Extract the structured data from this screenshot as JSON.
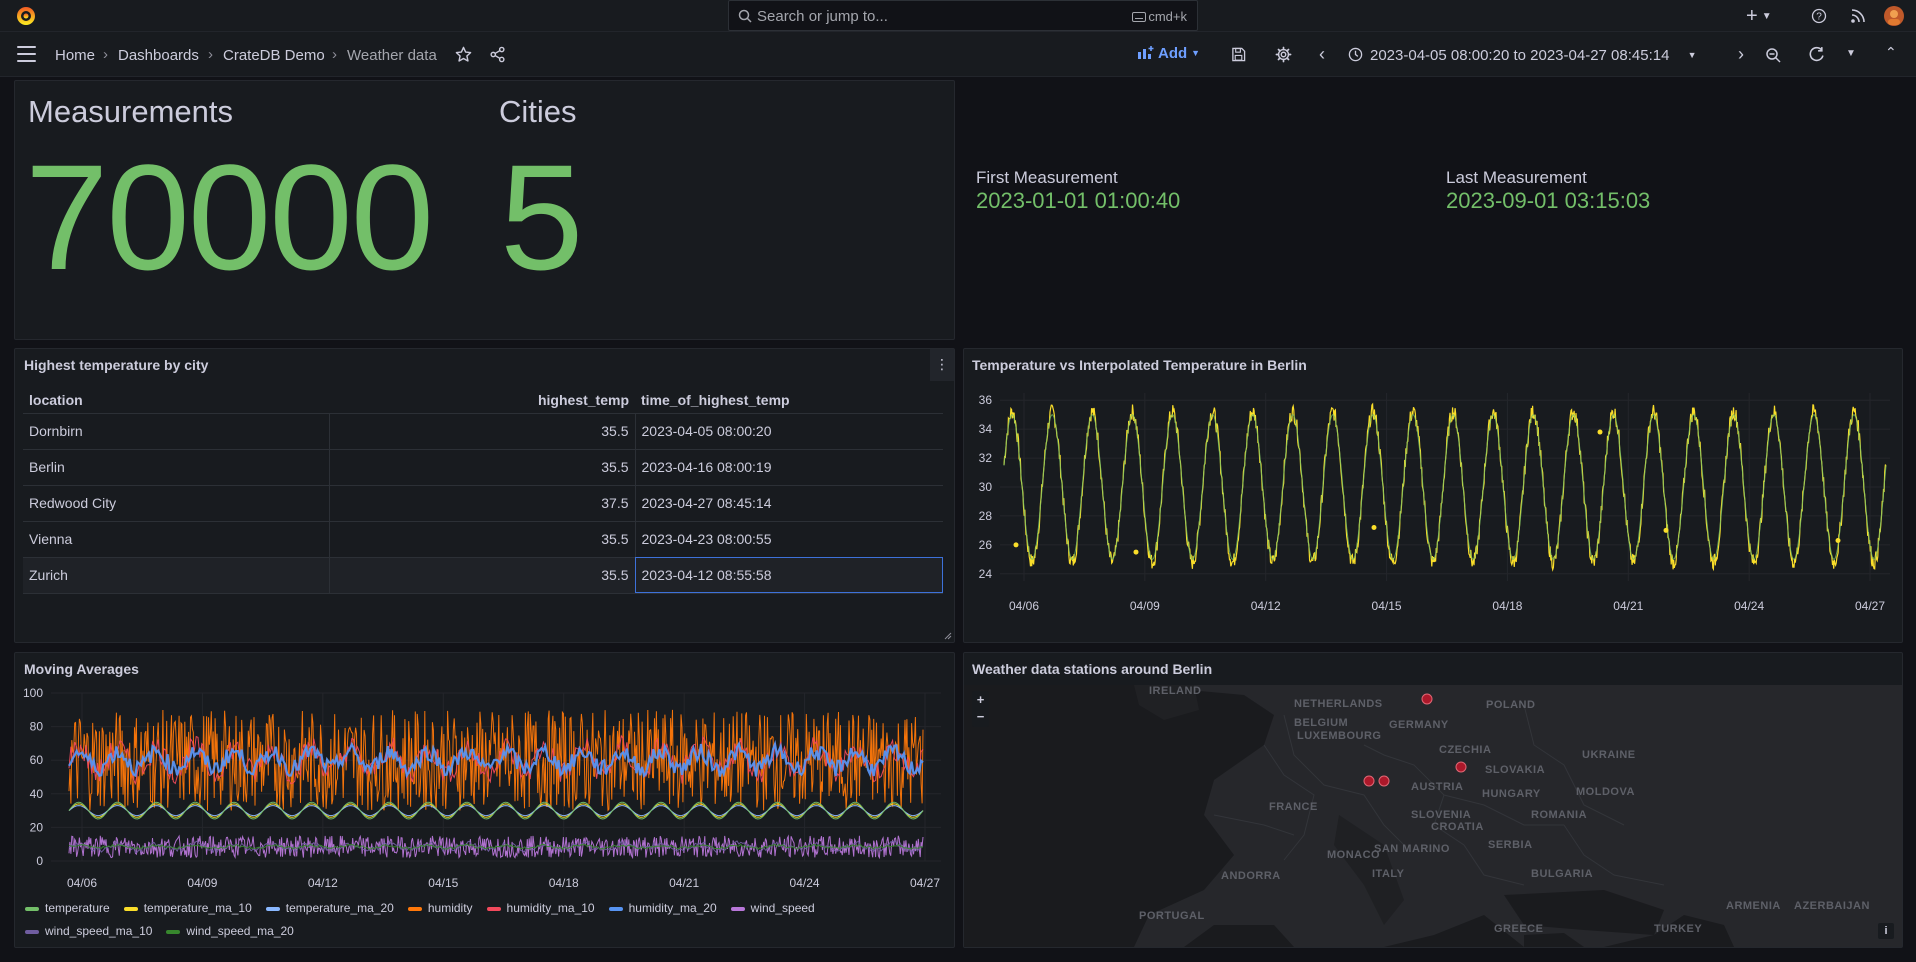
{
  "topbar": {
    "search_placeholder": "Search or jump to...",
    "search_shortcut": "cmd+k"
  },
  "breadcrumb": {
    "items": [
      "Home",
      "Dashboards",
      "CrateDB Demo",
      "Weather data"
    ]
  },
  "toolbar": {
    "add_label": "Add",
    "time_from": "2023-04-05 08:00:20",
    "time_to_word": "to",
    "time_to": "2023-04-27 08:45:14"
  },
  "stats": {
    "measurements_title": "Measurements",
    "measurements_value": "70000",
    "cities_title": "Cities",
    "cities_value": "5",
    "first_title": "First Measurement",
    "first_value": "2023-01-01 01:00:40",
    "last_title": "Last Measurement",
    "last_value": "2023-09-01 03:15:03"
  },
  "table_panel": {
    "title": "Highest temperature by city",
    "columns": [
      "location",
      "highest_temp",
      "time_of_highest_temp"
    ],
    "rows": [
      [
        "Dornbirn",
        "35.5",
        "2023-04-05 08:00:20"
      ],
      [
        "Berlin",
        "35.5",
        "2023-04-16 08:00:19"
      ],
      [
        "Redwood City",
        "37.5",
        "2023-04-27 08:45:14"
      ],
      [
        "Vienna",
        "35.5",
        "2023-04-23 08:00:55"
      ],
      [
        "Zurich",
        "35.5",
        "2023-04-12 08:55:58"
      ]
    ]
  },
  "map_panel": {
    "title": "Weather data stations around Berlin",
    "zoom_in": "+",
    "zoom_out": "−",
    "info": "i",
    "labels": [
      "IRELAND",
      "NETHERLANDS",
      "POLAND",
      "BELGIUM",
      "GERMANY",
      "LUXEMBOURG",
      "CZECHIA",
      "UKRAINE",
      "SLOVAKIA",
      "AUSTRIA",
      "MOLDOVA",
      "FRANCE",
      "HUNGARY",
      "SLOVENIA",
      "ROMANIA",
      "CROATIA",
      "SERBIA",
      "MONACO",
      "SAN MARINO",
      "ANDORRA",
      "ITALY",
      "BULGARIA",
      "PORTUGAL",
      "GREECE",
      "TURKEY",
      "ARMENIA",
      "AZERBAIJAN"
    ]
  },
  "chart_data": [
    {
      "type": "line",
      "title": "Temperature vs Interpolated Temperature in Berlin",
      "x_tick_labels": [
        "04/06",
        "04/09",
        "04/12",
        "04/15",
        "04/18",
        "04/21",
        "04/24",
        "04/27"
      ],
      "y_ticks": [
        24,
        26,
        28,
        30,
        32,
        34,
        36
      ],
      "ylim": [
        23.5,
        36.5
      ],
      "series": [
        {
          "color": "#fade2a",
          "cycles": 22,
          "min": 24.8,
          "max": 35.2
        },
        {
          "color": "#73bf69",
          "cycles": 22,
          "min": 25.0,
          "max": 35.0
        }
      ]
    },
    {
      "type": "line",
      "title": "Moving Averages",
      "x_tick_labels": [
        "04/06",
        "04/09",
        "04/12",
        "04/15",
        "04/18",
        "04/21",
        "04/24",
        "04/27"
      ],
      "y_ticks": [
        0,
        20,
        40,
        60,
        80,
        100
      ],
      "ylim": [
        0,
        100
      ],
      "series": [
        {
          "name": "temperature",
          "color": "#73bf69",
          "range": [
            25,
            35
          ]
        },
        {
          "name": "temperature_ma_10",
          "color": "#fade2a",
          "range": [
            26,
            34
          ]
        },
        {
          "name": "temperature_ma_20",
          "color": "#8ab8ff",
          "range": [
            27,
            33
          ]
        },
        {
          "name": "humidity",
          "color": "#ff780a",
          "range": [
            30,
            90
          ]
        },
        {
          "name": "humidity_ma_10",
          "color": "#f2495c",
          "range": [
            45,
            75
          ]
        },
        {
          "name": "humidity_ma_20",
          "color": "#5794f2",
          "range": [
            50,
            70
          ]
        },
        {
          "name": "wind_speed",
          "color": "#b877d9",
          "range": [
            2,
            15
          ]
        },
        {
          "name": "wind_speed_ma_10",
          "color": "#705da0",
          "range": [
            5,
            12
          ]
        },
        {
          "name": "wind_speed_ma_20",
          "color": "#37872d",
          "range": [
            7,
            10
          ]
        }
      ]
    }
  ],
  "colors": {
    "accent_green": "#73bf69",
    "accent_blue": "#6e9fff",
    "background": "#111217",
    "panel": "#181b1f"
  }
}
